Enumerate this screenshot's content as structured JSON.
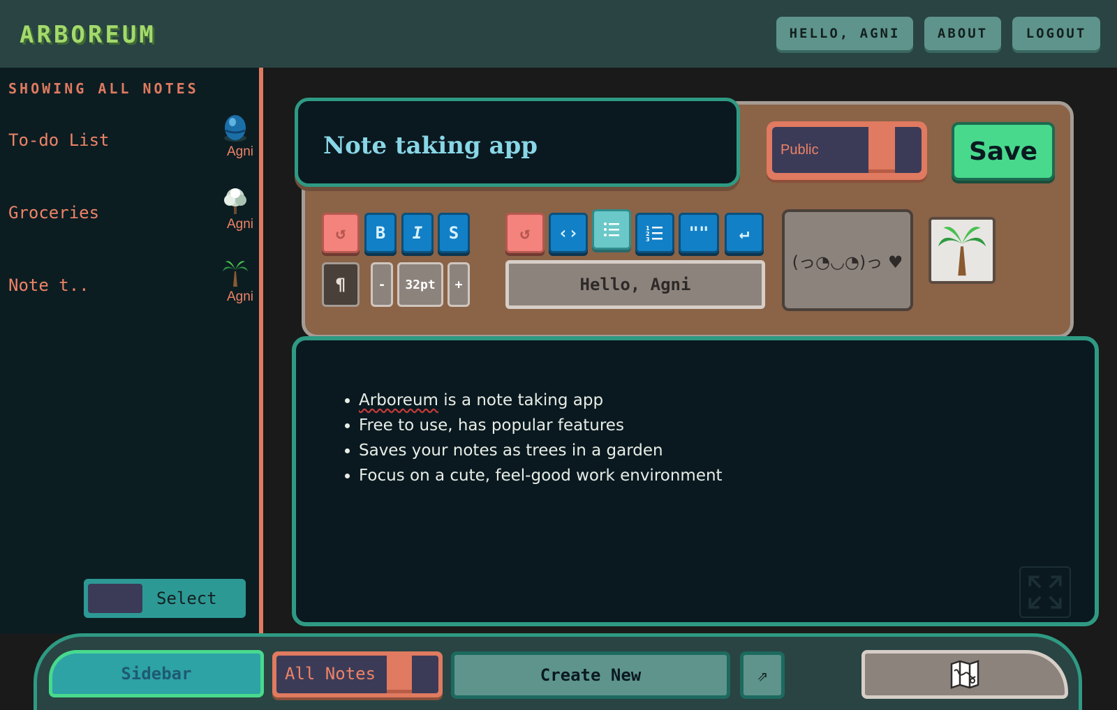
{
  "app": {
    "logo": "ARBOREUM"
  },
  "header": {
    "nav": [
      "HELLO, AGNI",
      "ABOUT",
      "LOGOUT"
    ]
  },
  "sidebar": {
    "heading": "SHOWING ALL NOTES",
    "notes": [
      {
        "title": "To-do List",
        "author": "Agni",
        "icon": "blue-egg-icon"
      },
      {
        "title": "Groceries",
        "author": "Agni",
        "icon": "white-tree-icon"
      },
      {
        "title": "Note t..",
        "author": "Agni",
        "icon": "palm-tree-icon"
      }
    ],
    "select_label": "Select"
  },
  "editor": {
    "title": "Note taking app",
    "visibility_label": "Public",
    "save_label": "Save",
    "toolbar": {
      "undo": "↺",
      "bold": "B",
      "italic": "I",
      "strike": "S",
      "redo": "↺",
      "code": "‹›",
      "bullet_list_icon": "bullet-list-icon",
      "ordered_list_icon": "ordered-list-icon",
      "quote": "\"\"",
      "enter": "↵",
      "paragraph": "¶",
      "font_decrease": "-",
      "font_size": "32pt",
      "font_increase": "+"
    },
    "greeting": "Hello, Agni",
    "emoticon": "(っ◔◡◔)っ ♥",
    "tree_icon": "palm-tree-icon",
    "content": [
      {
        "lead": "Arboreum",
        "rest": " is a note taking app"
      },
      {
        "lead": "",
        "rest": "Free to use, has popular features"
      },
      {
        "lead": "",
        "rest": "Saves your notes as trees in a garden"
      },
      {
        "lead": "",
        "rest": "Focus on a cute, feel-good work environment"
      }
    ]
  },
  "bottom_bar": {
    "sidebar_label": "Sidebar",
    "all_notes_label": "All Notes",
    "create_label": "Create New",
    "arrow": "⇗",
    "map_icon": "map-icon"
  },
  "colors": {
    "header": "#294443",
    "sidebar_bg": "#0c1d22",
    "accent_coral": "#e07a60",
    "accent_teal": "#2f9a83",
    "save_green": "#48d98d",
    "panel_brown": "#8b6347",
    "tool_blue": "#1280c6"
  }
}
